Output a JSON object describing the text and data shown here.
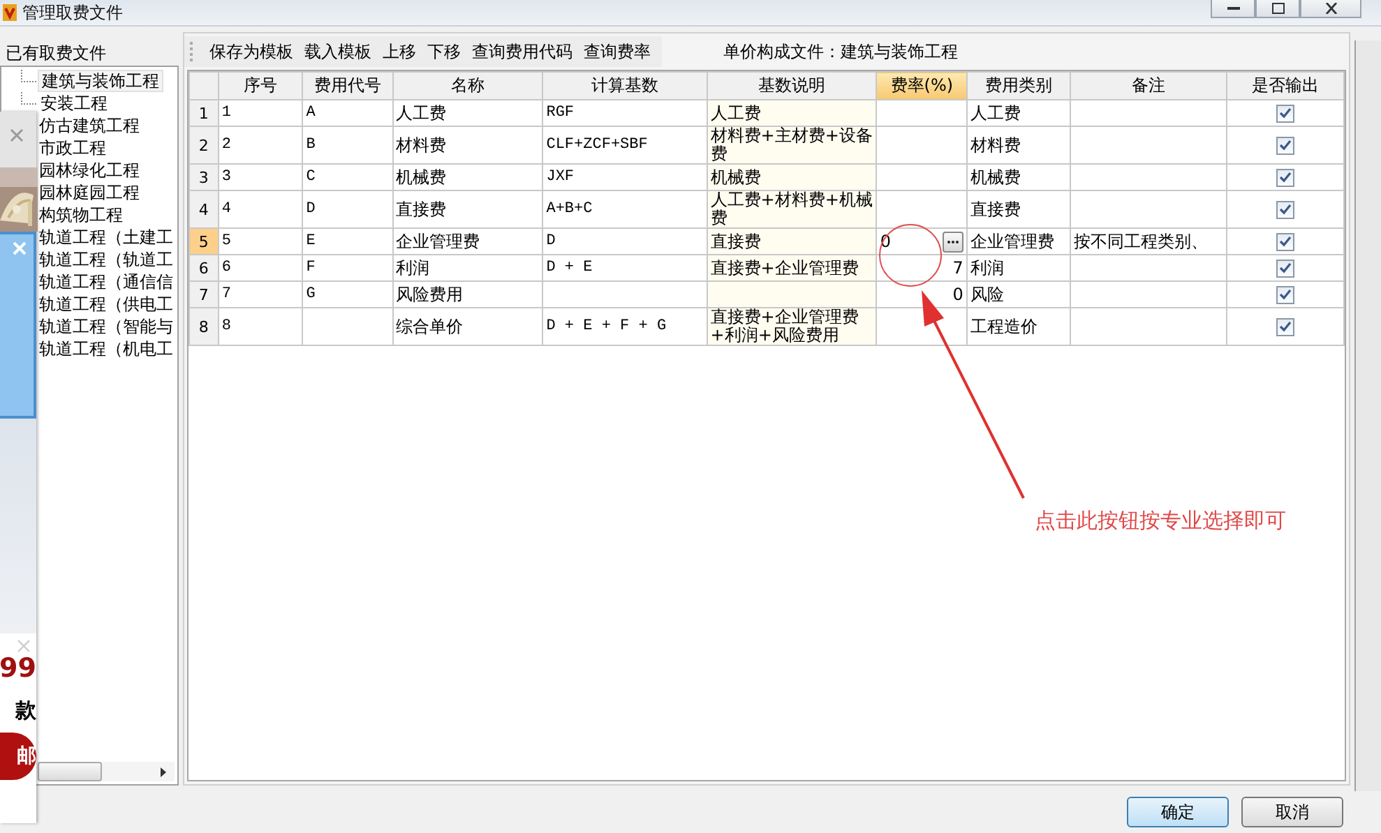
{
  "window": {
    "title": "管理取费文件"
  },
  "sidebar": {
    "header": "已有取费文件",
    "items": [
      {
        "label": "建筑与装饰工程",
        "selected": true
      },
      {
        "label": "安装工程",
        "selected": false
      },
      {
        "label": "仿古建筑工程",
        "selected": false
      },
      {
        "label": "市政工程",
        "selected": false
      },
      {
        "label": "园林绿化工程",
        "selected": false
      },
      {
        "label": "园林庭园工程",
        "selected": false
      },
      {
        "label": "构筑物工程",
        "selected": false
      },
      {
        "label": "轨道工程（土建工",
        "selected": false
      },
      {
        "label": "轨道工程（轨道工",
        "selected": false
      },
      {
        "label": "轨道工程（通信信",
        "selected": false
      },
      {
        "label": "轨道工程（供电工",
        "selected": false
      },
      {
        "label": "轨道工程（智能与",
        "selected": false
      },
      {
        "label": "轨道工程（机电工",
        "selected": false
      }
    ]
  },
  "toolbar": [
    "保存为模板",
    "载入模板",
    "上移",
    "下移",
    "查询费用代码",
    "查询费率"
  ],
  "file_label": "单价构成文件：建筑与装饰工程",
  "table": {
    "columns": [
      {
        "label": "序号",
        "selected": false
      },
      {
        "label": "费用代号",
        "selected": false
      },
      {
        "label": "名称",
        "selected": false
      },
      {
        "label": "计算基数",
        "selected": false
      },
      {
        "label": "基数说明",
        "selected": false
      },
      {
        "label": "费率(%)",
        "selected": true
      },
      {
        "label": "费用类别",
        "selected": false
      },
      {
        "label": "备注",
        "selected": false
      },
      {
        "label": "是否输出",
        "selected": false
      }
    ],
    "rows": [
      {
        "row_number": "1",
        "cells": [
          "1",
          "A",
          "人工费",
          "RGF",
          "人工费",
          "",
          "人工费",
          ""
        ],
        "output": true,
        "selected": false
      },
      {
        "row_number": "2",
        "cells": [
          "2",
          "B",
          "材料费",
          "CLF+ZCF+SBF",
          "材料费+主材费+设备费",
          "",
          "材料费",
          ""
        ],
        "output": true,
        "selected": false
      },
      {
        "row_number": "3",
        "cells": [
          "3",
          "C",
          "机械费",
          "JXF",
          "机械费",
          "",
          "机械费",
          ""
        ],
        "output": true,
        "selected": false
      },
      {
        "row_number": "4",
        "cells": [
          "4",
          "D",
          "直接费",
          "A+B+C",
          "人工费+材料费+机械费",
          "",
          "直接费",
          ""
        ],
        "output": true,
        "selected": false
      },
      {
        "row_number": "5",
        "cells": [
          "5",
          "E",
          "企业管理费",
          "D",
          "直接费",
          "0",
          "企业管理费",
          "按不同工程类别、"
        ],
        "output": true,
        "selected": true
      },
      {
        "row_number": "6",
        "cells": [
          "6",
          "F",
          "利润",
          "D + E",
          "直接费+企业管理费",
          "7",
          "利润",
          ""
        ],
        "output": true,
        "selected": false
      },
      {
        "row_number": "7",
        "cells": [
          "7",
          "G",
          "风险费用",
          "",
          "",
          "0",
          "风险",
          ""
        ],
        "output": true,
        "selected": false
      },
      {
        "row_number": "8",
        "cells": [
          "8",
          "",
          "综合单价",
          "D + E + F + G",
          "直接费+企业管理费+利润+风险费用",
          "",
          "工程造价",
          ""
        ],
        "output": true,
        "selected": false
      }
    ]
  },
  "annotation": "点击此按钮按专业选择即可",
  "buttons": [
    "确定",
    "取消"
  ],
  "ad_overlay": {
    "price": "99",
    "caption": "款",
    "badge": "邮"
  }
}
